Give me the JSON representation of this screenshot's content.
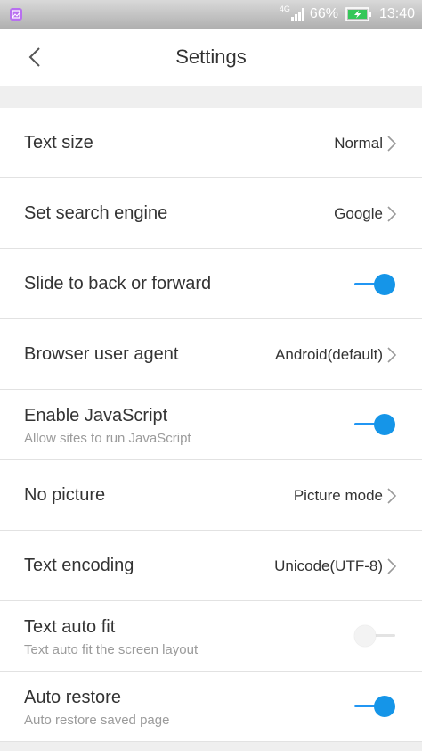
{
  "status_bar": {
    "network": "4G",
    "battery": "66%",
    "time": "13:40"
  },
  "app_bar": {
    "title": "Settings"
  },
  "settings": {
    "text_size": {
      "label": "Text size",
      "value": "Normal"
    },
    "search_engine": {
      "label": "Set search engine",
      "value": "Google"
    },
    "slide_nav": {
      "label": "Slide to back or forward",
      "enabled": true
    },
    "user_agent": {
      "label": "Browser user agent",
      "value": "Android(default)"
    },
    "javascript": {
      "label": "Enable JavaScript",
      "description": "Allow sites to run JavaScript",
      "enabled": true
    },
    "no_picture": {
      "label": "No picture",
      "value": "Picture mode"
    },
    "text_encoding": {
      "label": "Text encoding",
      "value": "Unicode(UTF-8)"
    },
    "text_auto_fit": {
      "label": "Text auto fit",
      "description": "Text auto fit the screen layout",
      "enabled": false
    },
    "auto_restore": {
      "label": "Auto restore",
      "description": "Auto restore saved page",
      "enabled": true
    }
  },
  "colors": {
    "accent": "#1595e8",
    "status_bar": "#bdbdbd",
    "divider": "#e2e2e2"
  }
}
